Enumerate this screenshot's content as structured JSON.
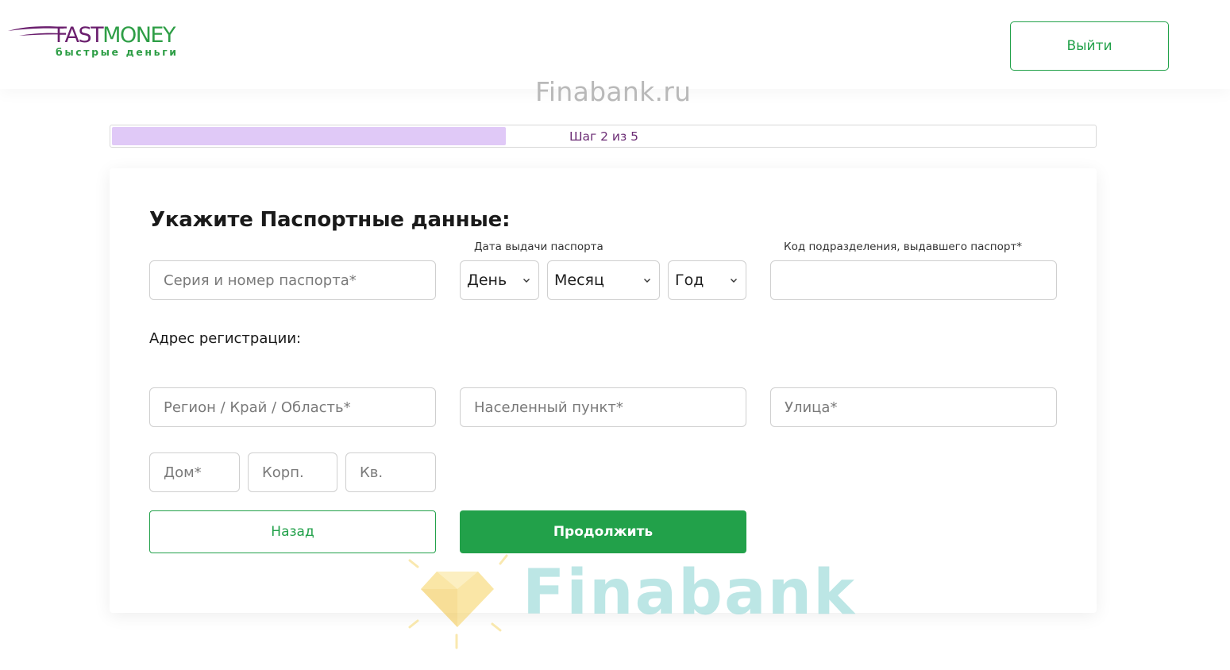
{
  "header": {
    "logo": {
      "word_part1": "FAST",
      "word_part2": "MONEY",
      "tagline": "быстрые деньги"
    },
    "logout_label": "Выйти",
    "watermark_top": "Finabank.ru"
  },
  "progress": {
    "label": "Шаг 2 из 5",
    "fraction": 0.4,
    "fill_color": "#e0c9f7"
  },
  "form": {
    "title": "Укажите Паспортные данные:",
    "passport_number": {
      "placeholder": "Серия и номер паспорта",
      "required_mark": "*"
    },
    "issue_date": {
      "label": "Дата выдачи паспорта",
      "day": "День",
      "month": "Месяц",
      "year": "Год"
    },
    "division_code": {
      "label": "Код подразделения, выдавшего паспорт*",
      "value": ""
    },
    "address_label": "Адрес регистрации:",
    "region": {
      "placeholder": "Регион / Край / Область",
      "required_mark": "*"
    },
    "locality": {
      "placeholder": "Населенный пункт",
      "required_mark": "*"
    },
    "street": {
      "placeholder": "Улица",
      "required_mark": "*"
    },
    "house": {
      "placeholder": "Дом",
      "required_mark": "*"
    },
    "building": {
      "placeholder": "Корп."
    },
    "apartment": {
      "placeholder": "Кв."
    },
    "back_label": "Назад",
    "continue_label": "Продолжить"
  },
  "watermark_bottom": "Finabank",
  "colors": {
    "accent_green": "#22a14a",
    "brand_purple": "#6b1f6e",
    "progress_text": "#6b2c74"
  }
}
